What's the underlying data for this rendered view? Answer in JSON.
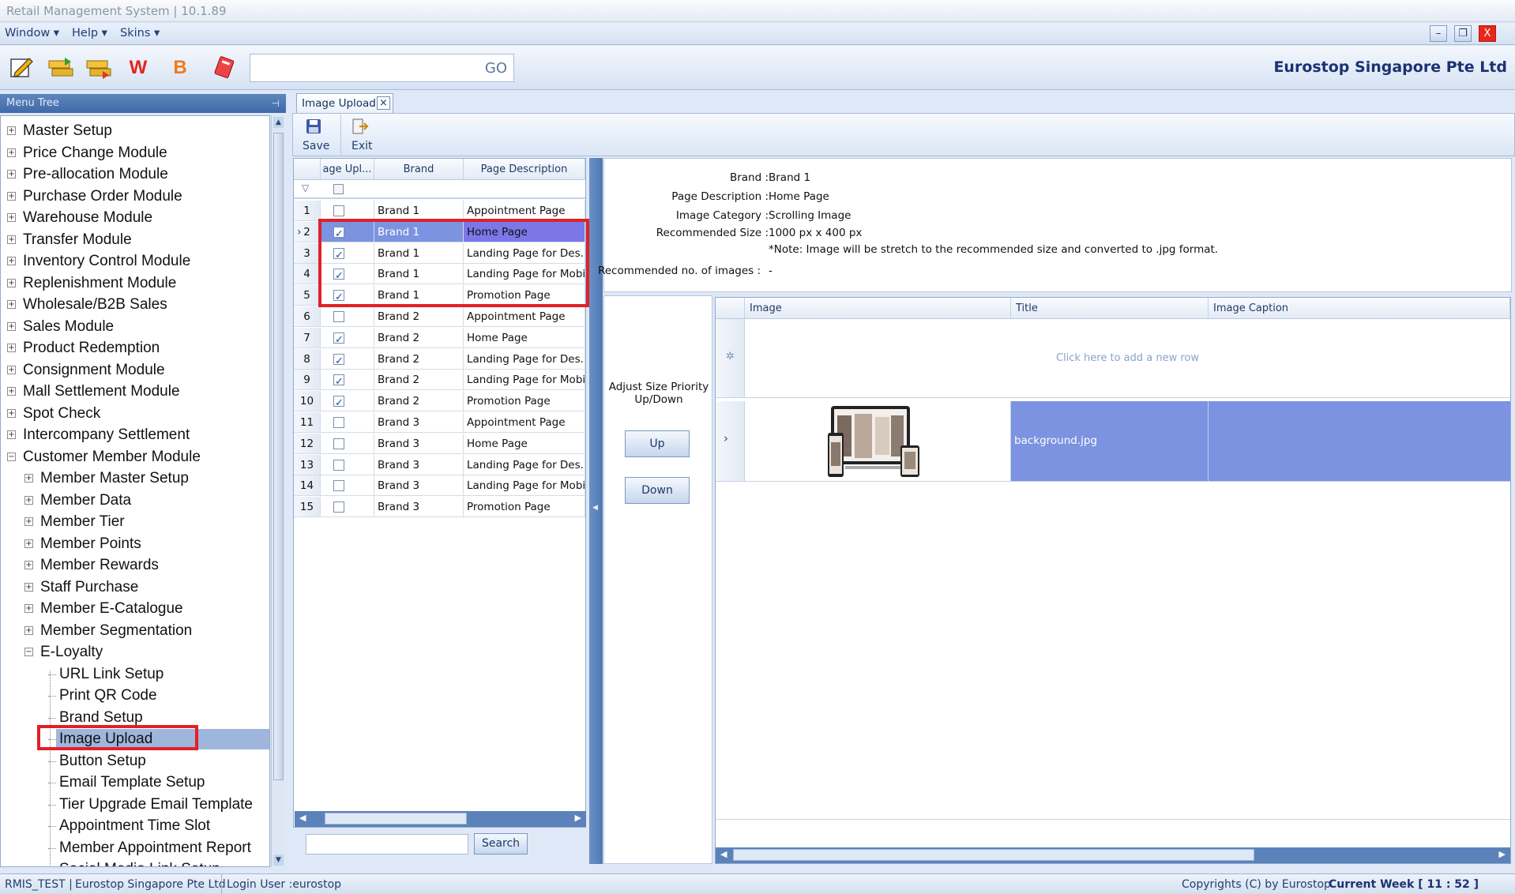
{
  "window": {
    "title": "Retail Management System | 10.1.89",
    "minimize": "–",
    "restore": "❐",
    "close": "X"
  },
  "menu": {
    "items": [
      "Window ▾",
      "Help ▾",
      "Skins ▾"
    ]
  },
  "toolbar": {
    "go_label": "GO",
    "company": "Eurostop Singapore Pte Ltd",
    "search_value": ""
  },
  "sidebar": {
    "title": "Menu Tree",
    "pin": "⊣",
    "top_items": [
      "Master Setup",
      "Price Change Module",
      "Pre-allocation Module",
      "Purchase Order Module",
      "Warehouse Module",
      "Transfer Module",
      "Inventory Control Module",
      "Replenishment Module",
      "Wholesale/B2B Sales",
      "Sales Module",
      "Product Redemption",
      "Consignment Module",
      "Mall Settlement Module",
      "Spot Check",
      "Intercompany Settlement",
      "Customer Member Module"
    ],
    "member_items": [
      "Member Master Setup",
      "Member Data",
      "Member Tier",
      "Member Points",
      "Member Rewards",
      "Staff Purchase",
      "Member E-Catalogue",
      "Member Segmentation",
      "E-Loyalty"
    ],
    "eloyalty_items": [
      "URL Link Setup",
      "Print QR Code",
      "Brand Setup",
      "Image Upload",
      "Button Setup",
      "Email Template Setup",
      "Tier Upgrade Email Template",
      "Appointment Time Slot",
      "Member Appointment Report",
      "Social Media Link Setup"
    ],
    "selected": "Image Upload"
  },
  "tab": {
    "label": "Image Upload",
    "close": "×"
  },
  "ribbon": {
    "save_label": "Save",
    "exit_label": "Exit"
  },
  "list_grid": {
    "columns": [
      "age Upl...",
      "Brand",
      "Page Description"
    ],
    "rows": [
      {
        "no": "1",
        "checked": false,
        "brand": "Brand 1",
        "page": "Appointment Page"
      },
      {
        "no": "2",
        "checked": true,
        "brand": "Brand 1",
        "page": "Home Page"
      },
      {
        "no": "3",
        "checked": true,
        "brand": "Brand 1",
        "page": "Landing Page for Des..."
      },
      {
        "no": "4",
        "checked": true,
        "brand": "Brand 1",
        "page": "Landing Page for Mobile"
      },
      {
        "no": "5",
        "checked": true,
        "brand": "Brand 1",
        "page": "Promotion Page"
      },
      {
        "no": "6",
        "checked": false,
        "brand": "Brand 2",
        "page": "Appointment Page"
      },
      {
        "no": "7",
        "checked": true,
        "brand": "Brand 2",
        "page": "Home Page"
      },
      {
        "no": "8",
        "checked": true,
        "brand": "Brand 2",
        "page": "Landing Page for Des..."
      },
      {
        "no": "9",
        "checked": true,
        "brand": "Brand 2",
        "page": "Landing Page for Mobile"
      },
      {
        "no": "10",
        "checked": true,
        "brand": "Brand 2",
        "page": "Promotion Page"
      },
      {
        "no": "11",
        "checked": false,
        "brand": "Brand 3",
        "page": "Appointment Page"
      },
      {
        "no": "12",
        "checked": false,
        "brand": "Brand 3",
        "page": "Home Page"
      },
      {
        "no": "13",
        "checked": false,
        "brand": "Brand 3",
        "page": "Landing Page for Des..."
      },
      {
        "no": "14",
        "checked": false,
        "brand": "Brand 3",
        "page": "Landing Page for Mobile"
      },
      {
        "no": "15",
        "checked": false,
        "brand": "Brand 3",
        "page": "Promotion Page"
      }
    ],
    "selected_row": "2",
    "search_button": "Search",
    "search_value": ""
  },
  "details": {
    "brand_label": "Brand :",
    "brand_value": "Brand 1",
    "page_label": "Page Description :",
    "page_value": "Home Page",
    "category_label": "Image Category :",
    "category_value": "Scrolling Image",
    "size_label": "Recommended Size :",
    "size_value": "1000 px x 400 px",
    "note": "*Note: Image will be stretch to the recommended size and converted to .jpg format.",
    "count_label": "Recommended no. of images :",
    "count_value": "-"
  },
  "adjust": {
    "label": "Adjust Size Priority Up/Down",
    "up": "Up",
    "down": "Down"
  },
  "image_grid": {
    "columns": [
      "Image",
      "Title",
      "Image Caption"
    ],
    "new_row_text": "Click here to add a new row",
    "rows": [
      {
        "title": "background.jpg",
        "caption": ""
      }
    ]
  },
  "statusbar": {
    "db": "RMIS_TEST |",
    "company": "Eurostop Singapore Pte Ltd",
    "user": "Login User :eurostop",
    "copyright": "Copyrights (C) by Eurostop",
    "week": "Current Week [ 11 : 52 ]"
  },
  "colors": {
    "selection": "#7b93e0",
    "highlight_box": "#e02127",
    "company": "#1b3272"
  }
}
